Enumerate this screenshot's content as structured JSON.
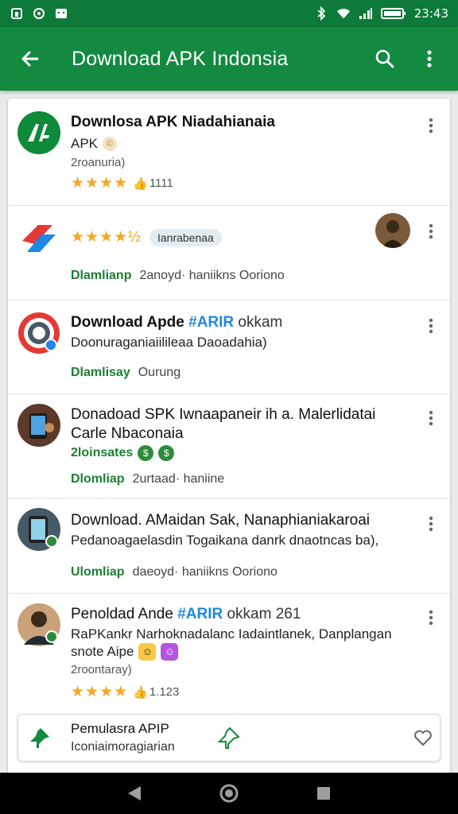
{
  "status_bar": {
    "left_icons": [
      "notification-icon-1",
      "notification-icon-2",
      "notification-icon-3"
    ],
    "time": "23:43"
  },
  "app_bar": {
    "title": "Download APK Indonsia"
  },
  "items": [
    {
      "title": "Downlosa APK Niadahianaia",
      "sub": "APK",
      "count": "2roanuria)",
      "rating_count": "1111"
    },
    {
      "chip": "Ianrabenaa",
      "link": "Dlamlianp",
      "meta": "2anoyd· haniikns Ooriono"
    },
    {
      "title_main": "Download Apde",
      "title_accent": "#ARIR",
      "title_tail": "okkam",
      "sub": "Doonuraganiaiilileaa Daoadahia)",
      "link": "Dlamlisay",
      "meta": "Ourung"
    },
    {
      "title_line1": "Donadoad SPK Iwnaapaneir ih a. Malerlidatai",
      "title_line2": "Carle Nbaconaia",
      "count": "2loinsates",
      "link": "Dlomliap",
      "meta": "2urtaad· haniine"
    },
    {
      "title": "Download. AMaidan Sak, Nanaphianiakaroai",
      "sub": "Pedanoagaelasdin Togaikana danrk dnaotncas ba),",
      "link": "Ulomliap",
      "meta": "daeoyd· haniikns Ooriono"
    },
    {
      "title_main": "Penoldad Ande",
      "title_accent": "#ARIR",
      "title_tail": "okkam 261",
      "sub": "RaPKankr Narhoknadalanc Iadaintlanek, Danplangan",
      "sub2": "snote Aipe",
      "count": "2roontaray)",
      "rating_count": "1.123"
    }
  ],
  "bottom_card": {
    "title": "Pemulasra APIP",
    "sub": "Iconiaimoragiarian"
  },
  "colors": {
    "primary": "#138a3f",
    "status": "#0e7a3a",
    "accent": "#1e88e5",
    "star": "#f5a623",
    "link_green": "#1b7f32"
  }
}
